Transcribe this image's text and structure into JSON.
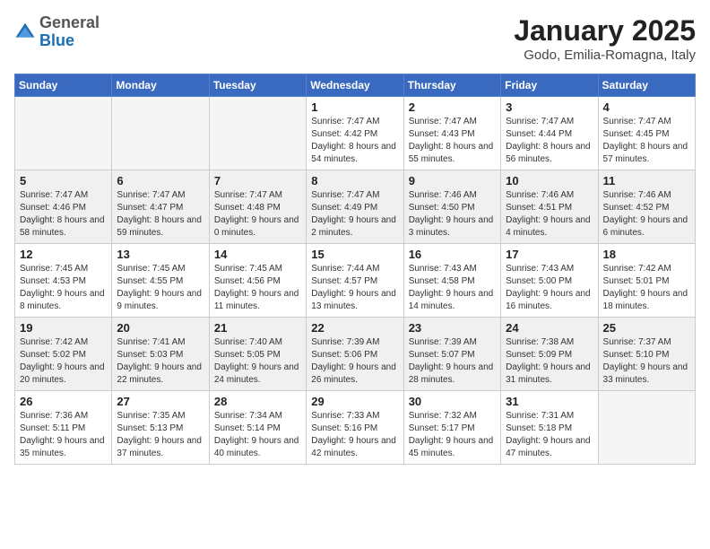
{
  "header": {
    "logo_general": "General",
    "logo_blue": "Blue",
    "month_title": "January 2025",
    "location": "Godo, Emilia-Romagna, Italy"
  },
  "days_of_week": [
    "Sunday",
    "Monday",
    "Tuesday",
    "Wednesday",
    "Thursday",
    "Friday",
    "Saturday"
  ],
  "weeks": [
    [
      {
        "day": "",
        "empty": true
      },
      {
        "day": "",
        "empty": true
      },
      {
        "day": "",
        "empty": true
      },
      {
        "day": "1",
        "sunrise": "Sunrise: 7:47 AM",
        "sunset": "Sunset: 4:42 PM",
        "daylight": "Daylight: 8 hours and 54 minutes."
      },
      {
        "day": "2",
        "sunrise": "Sunrise: 7:47 AM",
        "sunset": "Sunset: 4:43 PM",
        "daylight": "Daylight: 8 hours and 55 minutes."
      },
      {
        "day": "3",
        "sunrise": "Sunrise: 7:47 AM",
        "sunset": "Sunset: 4:44 PM",
        "daylight": "Daylight: 8 hours and 56 minutes."
      },
      {
        "day": "4",
        "sunrise": "Sunrise: 7:47 AM",
        "sunset": "Sunset: 4:45 PM",
        "daylight": "Daylight: 8 hours and 57 minutes."
      }
    ],
    [
      {
        "day": "5",
        "sunrise": "Sunrise: 7:47 AM",
        "sunset": "Sunset: 4:46 PM",
        "daylight": "Daylight: 8 hours and 58 minutes."
      },
      {
        "day": "6",
        "sunrise": "Sunrise: 7:47 AM",
        "sunset": "Sunset: 4:47 PM",
        "daylight": "Daylight: 8 hours and 59 minutes."
      },
      {
        "day": "7",
        "sunrise": "Sunrise: 7:47 AM",
        "sunset": "Sunset: 4:48 PM",
        "daylight": "Daylight: 9 hours and 0 minutes."
      },
      {
        "day": "8",
        "sunrise": "Sunrise: 7:47 AM",
        "sunset": "Sunset: 4:49 PM",
        "daylight": "Daylight: 9 hours and 2 minutes."
      },
      {
        "day": "9",
        "sunrise": "Sunrise: 7:46 AM",
        "sunset": "Sunset: 4:50 PM",
        "daylight": "Daylight: 9 hours and 3 minutes."
      },
      {
        "day": "10",
        "sunrise": "Sunrise: 7:46 AM",
        "sunset": "Sunset: 4:51 PM",
        "daylight": "Daylight: 9 hours and 4 minutes."
      },
      {
        "day": "11",
        "sunrise": "Sunrise: 7:46 AM",
        "sunset": "Sunset: 4:52 PM",
        "daylight": "Daylight: 9 hours and 6 minutes."
      }
    ],
    [
      {
        "day": "12",
        "sunrise": "Sunrise: 7:45 AM",
        "sunset": "Sunset: 4:53 PM",
        "daylight": "Daylight: 9 hours and 8 minutes."
      },
      {
        "day": "13",
        "sunrise": "Sunrise: 7:45 AM",
        "sunset": "Sunset: 4:55 PM",
        "daylight": "Daylight: 9 hours and 9 minutes."
      },
      {
        "day": "14",
        "sunrise": "Sunrise: 7:45 AM",
        "sunset": "Sunset: 4:56 PM",
        "daylight": "Daylight: 9 hours and 11 minutes."
      },
      {
        "day": "15",
        "sunrise": "Sunrise: 7:44 AM",
        "sunset": "Sunset: 4:57 PM",
        "daylight": "Daylight: 9 hours and 13 minutes."
      },
      {
        "day": "16",
        "sunrise": "Sunrise: 7:43 AM",
        "sunset": "Sunset: 4:58 PM",
        "daylight": "Daylight: 9 hours and 14 minutes."
      },
      {
        "day": "17",
        "sunrise": "Sunrise: 7:43 AM",
        "sunset": "Sunset: 5:00 PM",
        "daylight": "Daylight: 9 hours and 16 minutes."
      },
      {
        "day": "18",
        "sunrise": "Sunrise: 7:42 AM",
        "sunset": "Sunset: 5:01 PM",
        "daylight": "Daylight: 9 hours and 18 minutes."
      }
    ],
    [
      {
        "day": "19",
        "sunrise": "Sunrise: 7:42 AM",
        "sunset": "Sunset: 5:02 PM",
        "daylight": "Daylight: 9 hours and 20 minutes."
      },
      {
        "day": "20",
        "sunrise": "Sunrise: 7:41 AM",
        "sunset": "Sunset: 5:03 PM",
        "daylight": "Daylight: 9 hours and 22 minutes."
      },
      {
        "day": "21",
        "sunrise": "Sunrise: 7:40 AM",
        "sunset": "Sunset: 5:05 PM",
        "daylight": "Daylight: 9 hours and 24 minutes."
      },
      {
        "day": "22",
        "sunrise": "Sunrise: 7:39 AM",
        "sunset": "Sunset: 5:06 PM",
        "daylight": "Daylight: 9 hours and 26 minutes."
      },
      {
        "day": "23",
        "sunrise": "Sunrise: 7:39 AM",
        "sunset": "Sunset: 5:07 PM",
        "daylight": "Daylight: 9 hours and 28 minutes."
      },
      {
        "day": "24",
        "sunrise": "Sunrise: 7:38 AM",
        "sunset": "Sunset: 5:09 PM",
        "daylight": "Daylight: 9 hours and 31 minutes."
      },
      {
        "day": "25",
        "sunrise": "Sunrise: 7:37 AM",
        "sunset": "Sunset: 5:10 PM",
        "daylight": "Daylight: 9 hours and 33 minutes."
      }
    ],
    [
      {
        "day": "26",
        "sunrise": "Sunrise: 7:36 AM",
        "sunset": "Sunset: 5:11 PM",
        "daylight": "Daylight: 9 hours and 35 minutes."
      },
      {
        "day": "27",
        "sunrise": "Sunrise: 7:35 AM",
        "sunset": "Sunset: 5:13 PM",
        "daylight": "Daylight: 9 hours and 37 minutes."
      },
      {
        "day": "28",
        "sunrise": "Sunrise: 7:34 AM",
        "sunset": "Sunset: 5:14 PM",
        "daylight": "Daylight: 9 hours and 40 minutes."
      },
      {
        "day": "29",
        "sunrise": "Sunrise: 7:33 AM",
        "sunset": "Sunset: 5:16 PM",
        "daylight": "Daylight: 9 hours and 42 minutes."
      },
      {
        "day": "30",
        "sunrise": "Sunrise: 7:32 AM",
        "sunset": "Sunset: 5:17 PM",
        "daylight": "Daylight: 9 hours and 45 minutes."
      },
      {
        "day": "31",
        "sunrise": "Sunrise: 7:31 AM",
        "sunset": "Sunset: 5:18 PM",
        "daylight": "Daylight: 9 hours and 47 minutes."
      },
      {
        "day": "",
        "empty": true
      }
    ]
  ]
}
